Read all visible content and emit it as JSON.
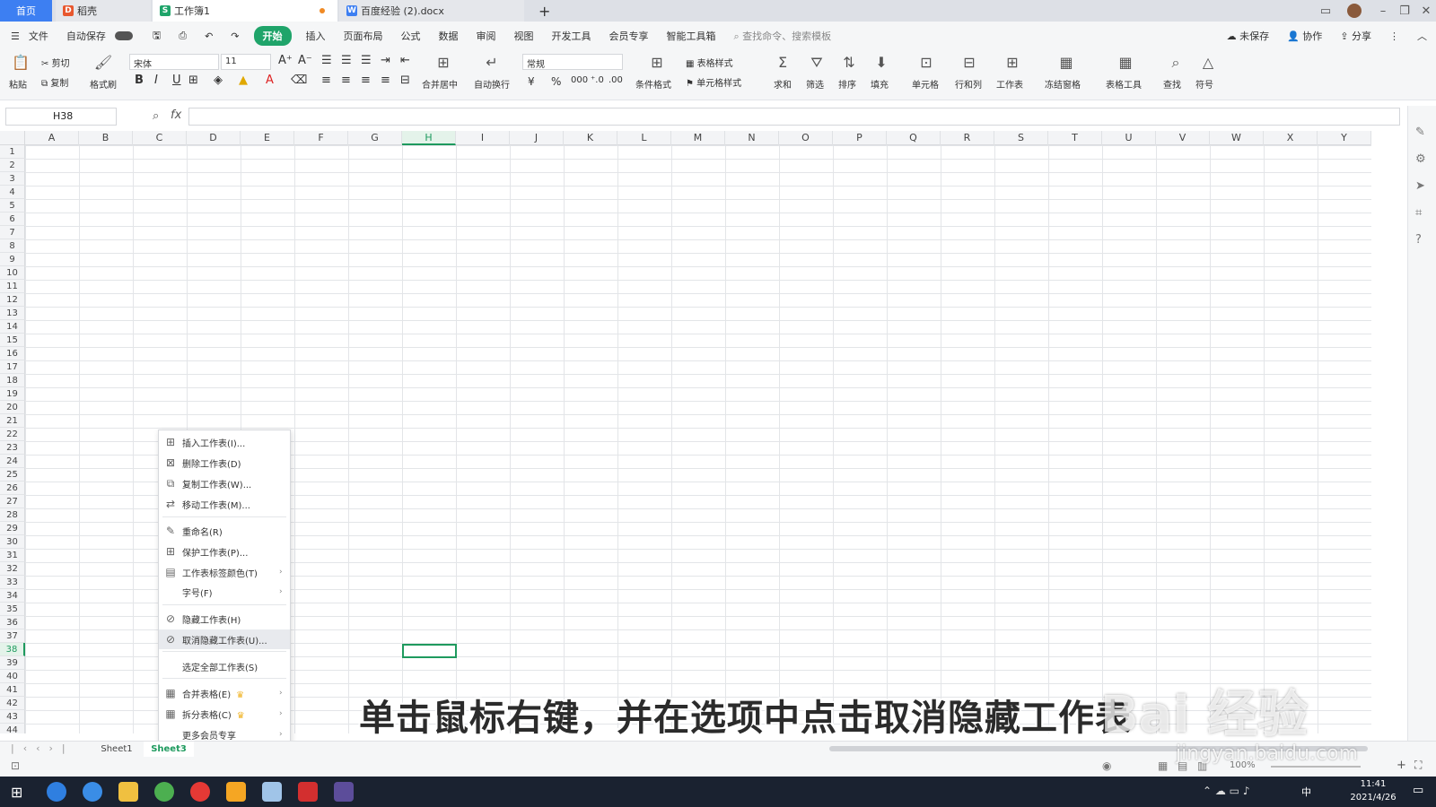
{
  "tabs": {
    "home": "首页",
    "daoke": "稻壳",
    "workbook": "工作簿1",
    "doc": "百度经验 (2).docx",
    "new": "+"
  },
  "menubar": {
    "file": "文件",
    "autosave": "自动保存",
    "items": [
      "开始",
      "插入",
      "页面布局",
      "公式",
      "数据",
      "审阅",
      "视图",
      "开发工具",
      "会员专享",
      "智能工具箱"
    ],
    "search": "查找命令、搜索模板",
    "unsaved": "未保存",
    "collab": "协作",
    "share": "分享"
  },
  "ribbon": {
    "paste": "粘贴",
    "cut": "剪切",
    "copy": "复制",
    "format_painter": "格式刷",
    "font": "宋体",
    "size": "11",
    "bold": "B",
    "italic": "I",
    "underline": "U",
    "merge": "合并居中",
    "wrap": "自动换行",
    "numformat": "常规",
    "currency": "¥",
    "percent": "%",
    "thousands": "000",
    "table_style": "表格样式",
    "cond_format": "条件格式",
    "cell_style": "单元格样式",
    "sum": "求和",
    "filter": "筛选",
    "sort": "排序",
    "fill": "填充",
    "cell": "单元格",
    "rowcol": "行和列",
    "sheet": "工作表",
    "freeze": "冻结窗格",
    "tabletools": "表格工具",
    "find": "查找",
    "symbol": "符号"
  },
  "formula": {
    "namebox": "H38",
    "fx": "fx"
  },
  "columns": [
    "A",
    "B",
    "C",
    "D",
    "E",
    "F",
    "G",
    "H",
    "I",
    "J",
    "K",
    "L",
    "M",
    "N",
    "O",
    "P",
    "Q",
    "R",
    "S",
    "T",
    "U",
    "V",
    "W",
    "X",
    "Y"
  ],
  "rows": [
    "1",
    "2",
    "3",
    "4",
    "5",
    "6",
    "7",
    "8",
    "9",
    "10",
    "11",
    "12",
    "13",
    "14",
    "15",
    "16",
    "17",
    "18",
    "19",
    "20",
    "21",
    "22",
    "23",
    "24",
    "25",
    "26",
    "27",
    "28",
    "29",
    "30",
    "31",
    "32",
    "33",
    "34",
    "35",
    "36",
    "37",
    "38",
    "39",
    "40",
    "41",
    "42",
    "43",
    "44"
  ],
  "context_menu": {
    "insert": "插入工作表(I)...",
    "delete": "删除工作表(D)",
    "copy": "复制工作表(W)...",
    "move": "移动工作表(M)...",
    "rename": "重命名(R)",
    "protect": "保护工作表(P)...",
    "tabcolor": "工作表标签颜色(T)",
    "fontsize": "字号(F)",
    "hide": "隐藏工作表(H)",
    "unhide": "取消隐藏工作表(U)...",
    "selectall": "选定全部工作表(S)",
    "merge": "合并表格(E)",
    "split": "拆分表格(C)",
    "more": "更多会员专享"
  },
  "sheets": {
    "sheet1": "Sheet1",
    "sheet3": "Sheet3"
  },
  "status": {
    "zoom": "100%"
  },
  "taskbar": {
    "time": "11:41",
    "date": "2021/4/26",
    "ime": "中"
  },
  "subtitle": "单击鼠标右键，并在选项中点击取消隐藏工作表",
  "watermark": {
    "main": "Bai 经验",
    "url": "jingyan.baidu.com"
  },
  "colors": {
    "accent": "#1fa46a",
    "home_tab": "#3d7ff2",
    "taskbar": "#1a2230"
  }
}
